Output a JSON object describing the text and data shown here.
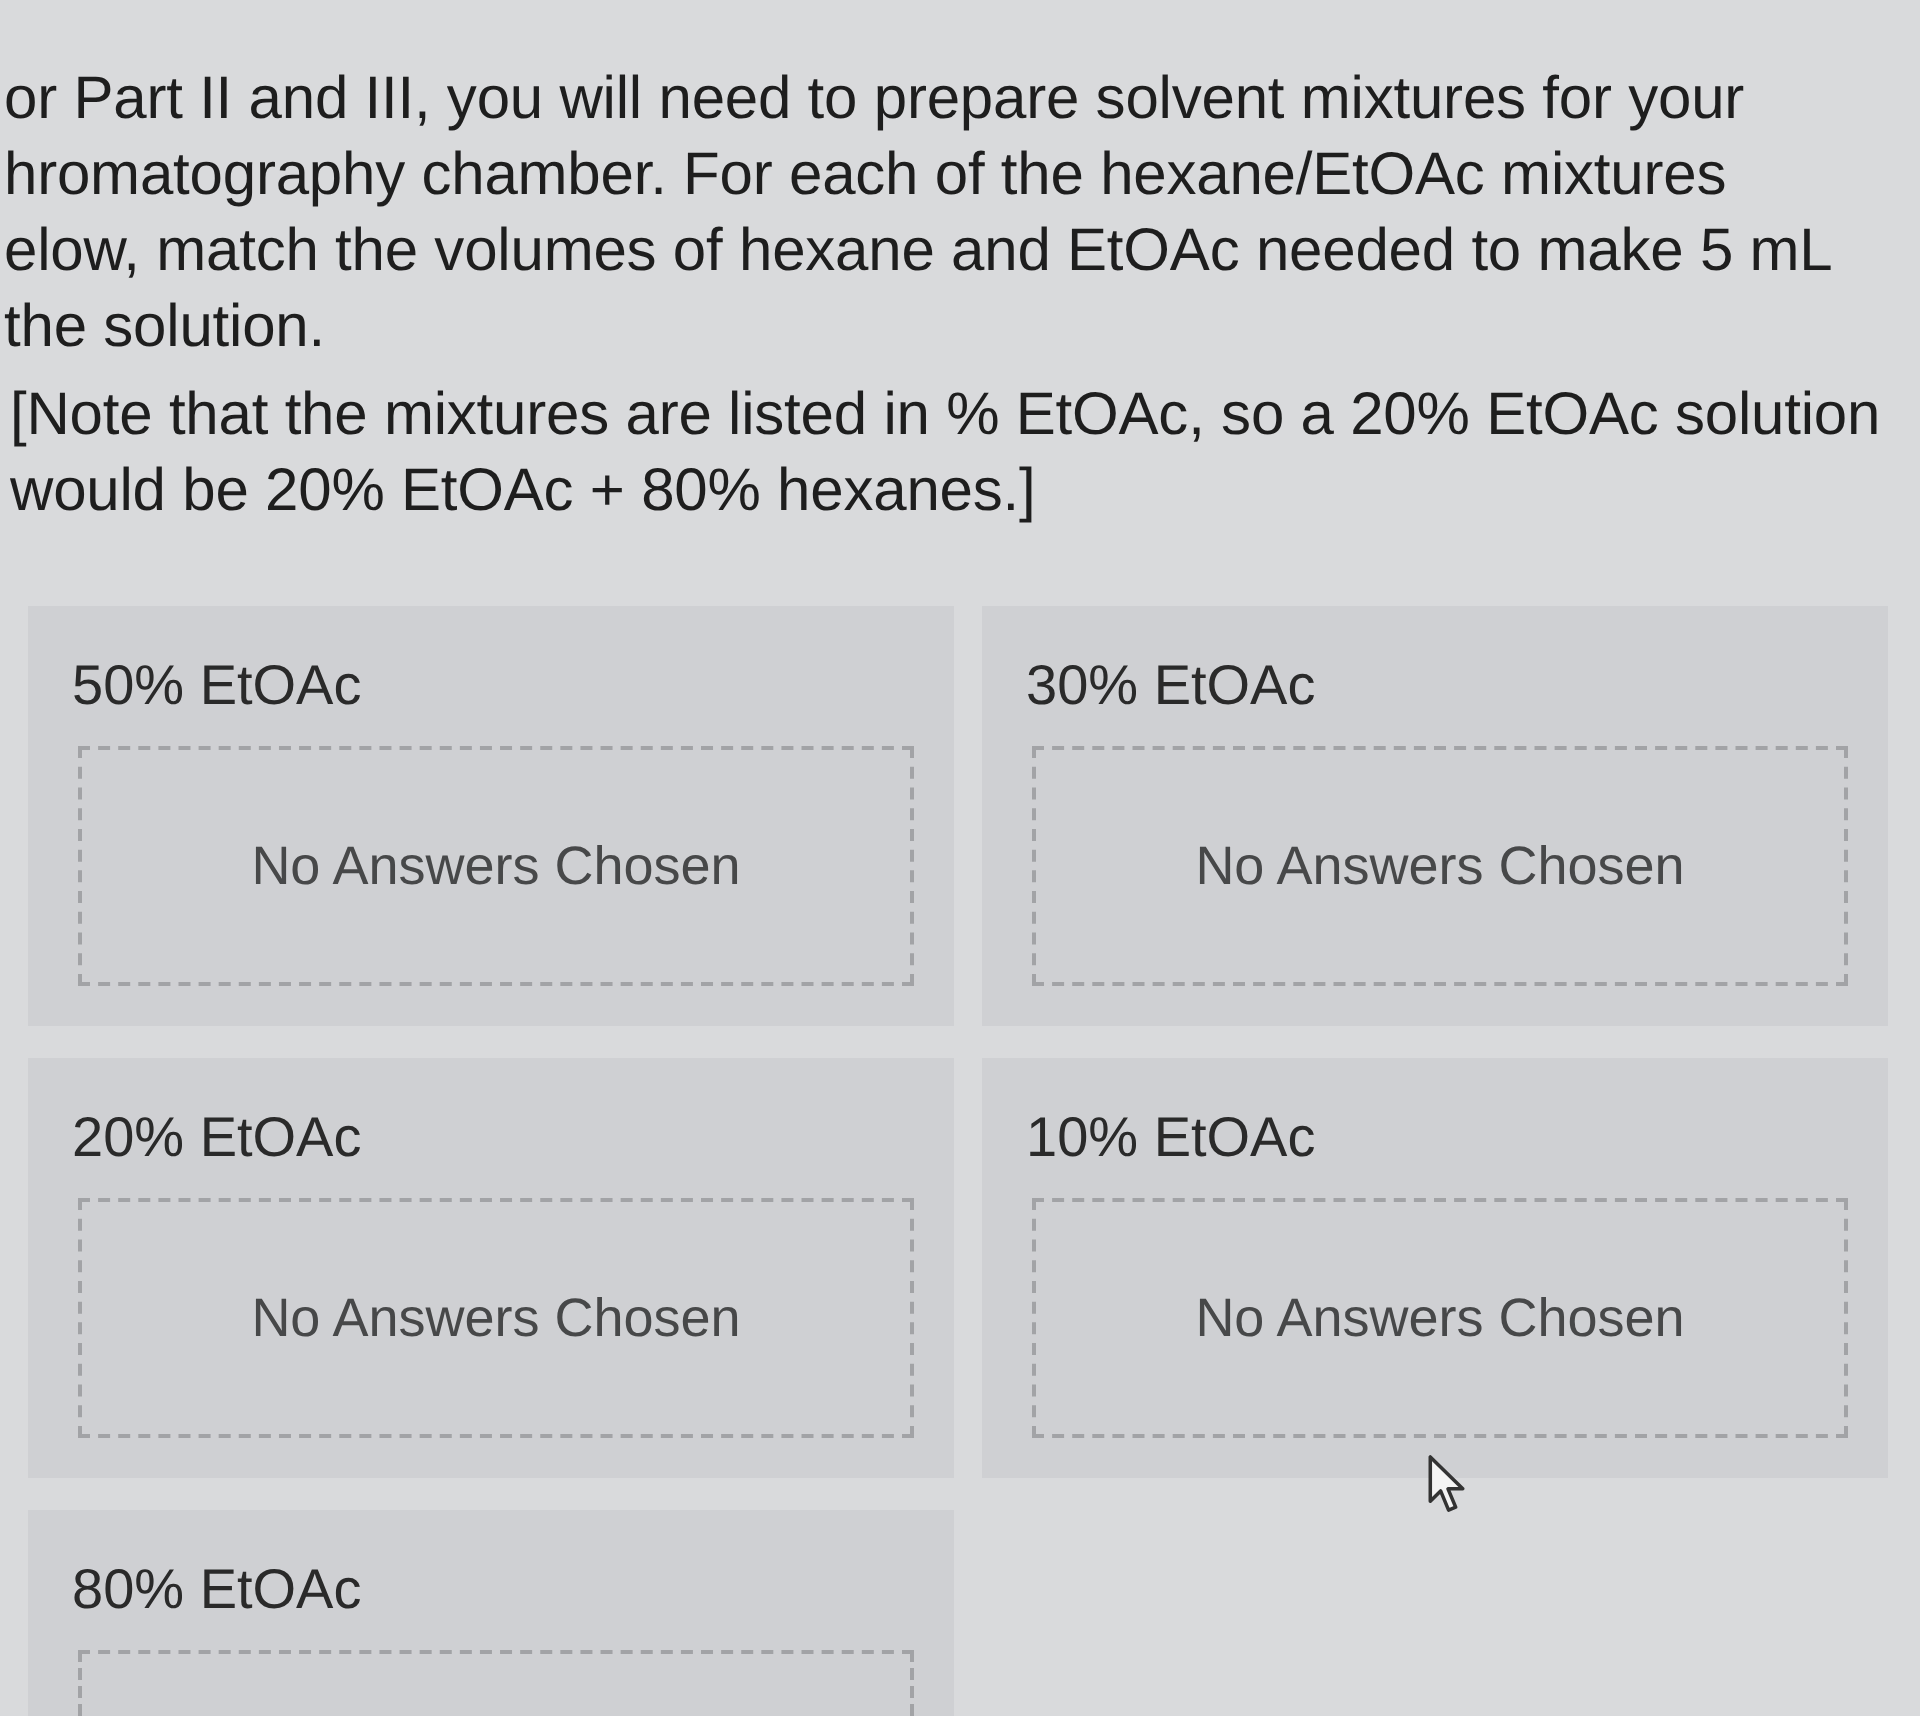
{
  "instructions": {
    "lines": [
      "or Part II and III, you will need to prepare solvent mixtures for your",
      "hromatography chamber. For each of the hexane/EtOAc mixtures",
      "elow, match the volumes of hexane and EtOAc needed to make 5 mL",
      "the solution."
    ]
  },
  "note": {
    "lines": [
      "[Note that the mixtures are listed in % EtOAc, so a 20% EtOAc solution",
      "would be 20% EtOAc + 80% hexanes.]"
    ]
  },
  "questions": [
    {
      "label": "50% EtOAc",
      "placeholder": "No Answers Chosen"
    },
    {
      "label": "30% EtOAc",
      "placeholder": "No Answers Chosen"
    },
    {
      "label": "20% EtOAc",
      "placeholder": "No Answers Chosen"
    },
    {
      "label": "10% EtOAc",
      "placeholder": "No Answers Chosen"
    },
    {
      "label": "80% EtOAc"
    }
  ]
}
